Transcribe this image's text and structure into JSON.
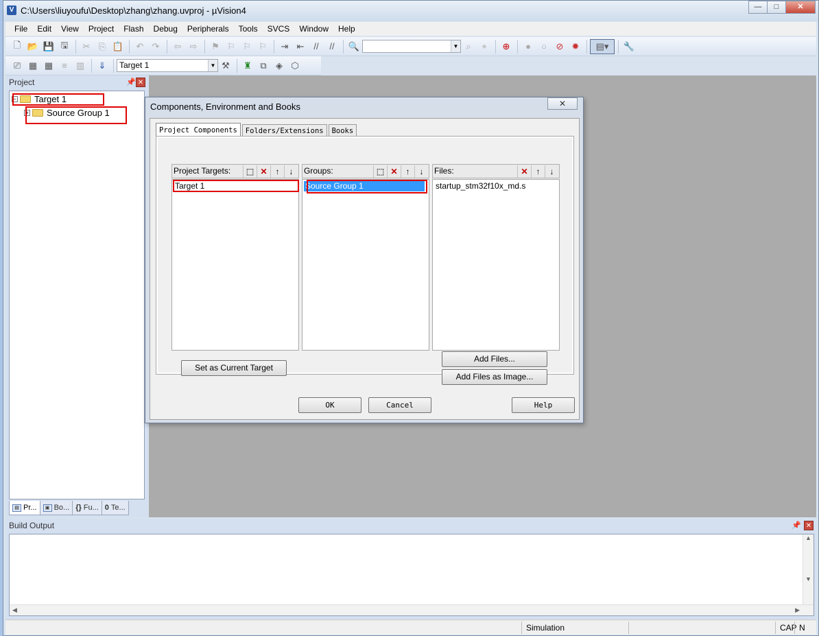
{
  "window": {
    "title": "C:\\Users\\liuyoufu\\Desktop\\zhang\\zhang.uvproj - µVision4",
    "controls": {
      "minimize": "—",
      "maximize": "□",
      "close": "✕"
    }
  },
  "menu": [
    "File",
    "Edit",
    "View",
    "Project",
    "Flash",
    "Debug",
    "Peripherals",
    "Tools",
    "SVCS",
    "Window",
    "Help"
  ],
  "toolbar": {
    "target_select": "Target 1",
    "find_combo": ""
  },
  "project_panel": {
    "title": "Project",
    "tree": {
      "target": "Target 1",
      "group": "Source Group 1",
      "target_expander": "−",
      "group_expander": "+"
    },
    "tabs": [
      "Pr...",
      "Bo...",
      "Fu...",
      "Te..."
    ]
  },
  "build_output": {
    "title": "Build Output",
    "content": ""
  },
  "status_bar": {
    "mode": "Simulation",
    "caps": "CAP",
    "num": "N"
  },
  "dialog": {
    "title": "Components, Environment and Books",
    "tabs": [
      "Project Components",
      "Folders/Extensions",
      "Books"
    ],
    "targets": {
      "label": "Project Targets:",
      "items": [
        "Target 1"
      ]
    },
    "groups": {
      "label": "Groups:",
      "items": [
        "Source Group 1"
      ]
    },
    "files": {
      "label": "Files:",
      "items": [
        "startup_stm32f10x_md.s"
      ]
    },
    "buttons": {
      "set_current": "Set as Current Target",
      "add_files": "Add Files...",
      "add_files_image": "Add Files as Image...",
      "ok": "OK",
      "cancel": "Cancel",
      "help": "Help"
    }
  },
  "colors": {
    "highlight": "#e00000",
    "selection": "#3399ff"
  }
}
